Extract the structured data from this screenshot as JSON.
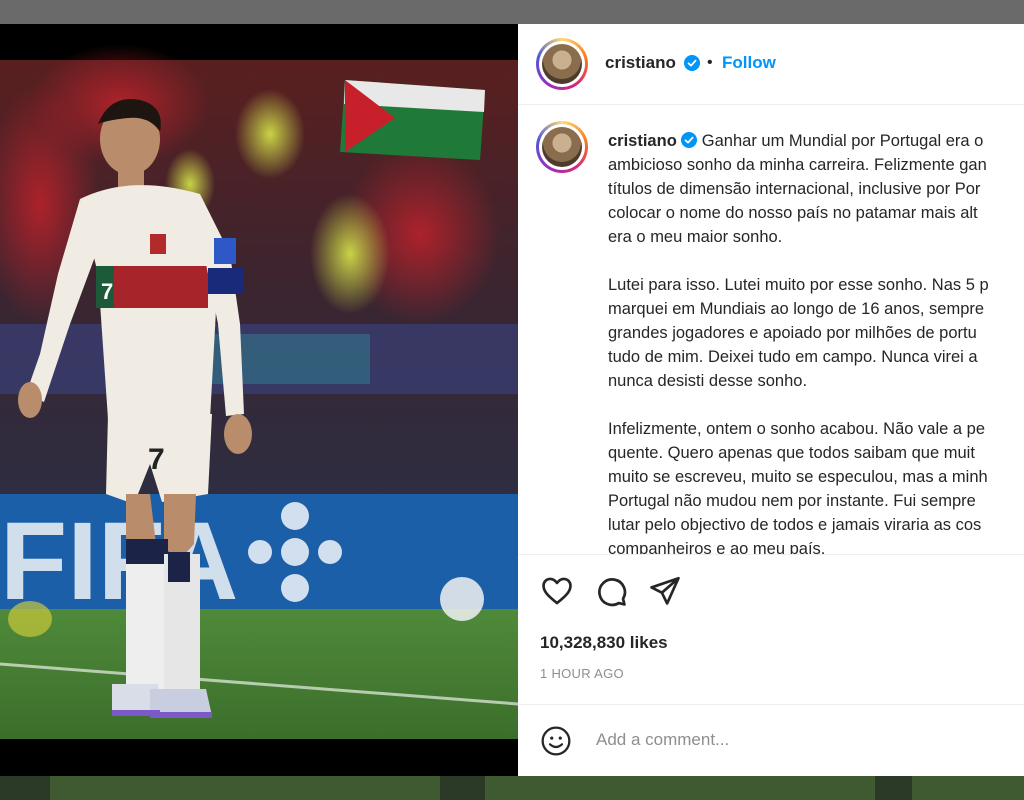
{
  "post": {
    "author": "cristiano",
    "follow_label": "Follow",
    "separator": "•",
    "verified_icon": "verified-badge-icon",
    "caption_first": "Ganhar um Mundial por Portugal era o\nambicioso sonho da minha carreira. Felizmente gan\ntítulos de dimensão internacional, inclusive por Por\ncolocar o nome do nosso país no patamar mais alt\nera o meu maior sonho.",
    "caption_paragraphs": [
      "Lutei para isso. Lutei muito por esse sonho. Nas 5 p\nmarquei em Mundiais ao longo de 16 anos, sempre\ngrandes jogadores e apoiado por milhões de portu\ntudo de mim. Deixei tudo em campo. Nunca virei a\nnunca desisti desse sonho.",
      "Infelizmente, ontem o sonho acabou. Não vale a pe\nquente. Quero apenas que todos saibam que muit\nmuito se escreveu, muito se especulou, mas a minh\nPortugal não mudou nem por instante. Fui sempre\nlutar pelo objectivo de todos e jamais viraria as cos\ncompanheiros e ao meu país."
    ],
    "likes": "10,328,830 likes",
    "time_ago": "1 HOUR AGO",
    "comment_placeholder": "Add a comment..."
  },
  "icons": [
    "heart-icon",
    "comment-icon",
    "share-icon",
    "emoji-icon",
    "verified-badge-icon"
  ],
  "colors": {
    "accent": "#0095f6",
    "text": "#262626",
    "muted": "#8e8e8e",
    "border": "#efefef"
  }
}
